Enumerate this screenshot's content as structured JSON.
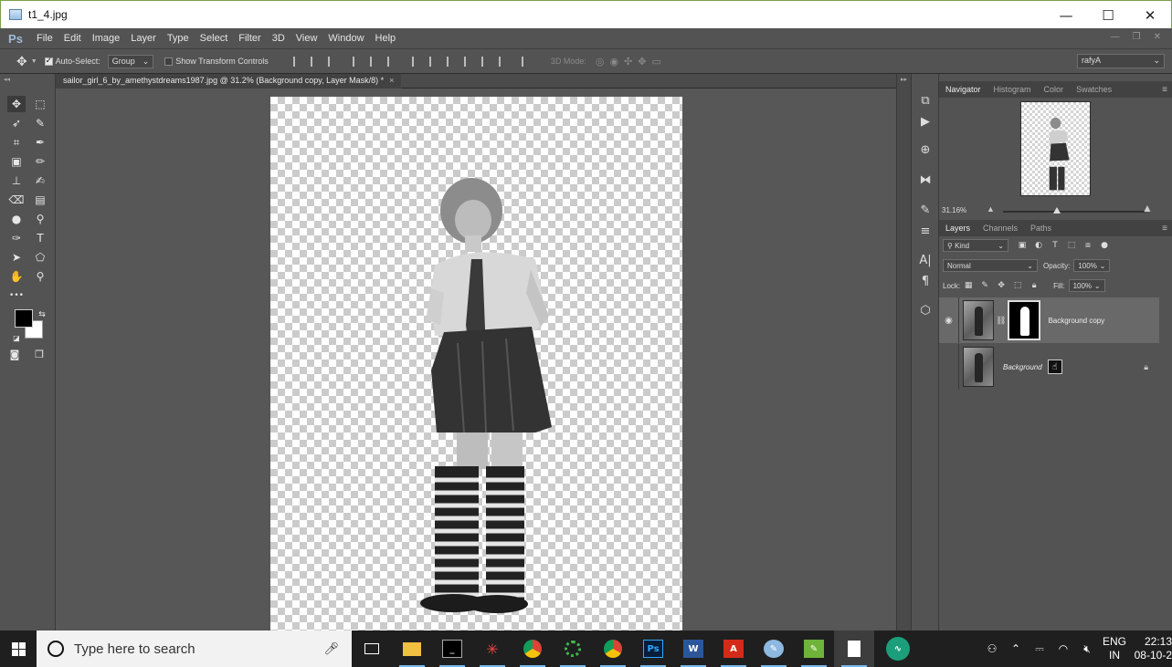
{
  "window": {
    "title": "t1_4.jpg",
    "min": "—",
    "max": "☐",
    "close": "✕"
  },
  "ps_logo": "Ps",
  "menus": [
    "File",
    "Edit",
    "Image",
    "Layer",
    "Type",
    "Select",
    "Filter",
    "3D",
    "View",
    "Window",
    "Help"
  ],
  "options": {
    "auto_select_label": "Auto-Select:",
    "auto_select_checked": true,
    "auto_select_value": "Group",
    "show_transform_label": "Show Transform Controls",
    "show_transform_checked": false,
    "mode_3d_label": "3D Mode:",
    "workspace": "rafyA"
  },
  "document": {
    "tab_title": "sailor_girl_6_by_amethystdreams1987.jpg @ 31.2% (Background copy, Layer Mask/8) *",
    "tab_close": "×"
  },
  "tools": [
    {
      "name": "move-tool",
      "glyph": "✥"
    },
    {
      "name": "marquee-tool",
      "glyph": "⬚"
    },
    {
      "name": "lasso-tool",
      "glyph": "➶"
    },
    {
      "name": "quick-select-tool",
      "glyph": "✎"
    },
    {
      "name": "crop-tool",
      "glyph": "⌗"
    },
    {
      "name": "eyedropper-tool",
      "glyph": "✒"
    },
    {
      "name": "healing-tool",
      "glyph": "▣"
    },
    {
      "name": "brush-tool",
      "glyph": "✏"
    },
    {
      "name": "stamp-tool",
      "glyph": "⊥"
    },
    {
      "name": "history-brush-tool",
      "glyph": "✍"
    },
    {
      "name": "eraser-tool",
      "glyph": "⌫"
    },
    {
      "name": "gradient-tool",
      "glyph": "▤"
    },
    {
      "name": "blur-tool",
      "glyph": "●"
    },
    {
      "name": "dodge-tool",
      "glyph": "⚲"
    },
    {
      "name": "pen-tool",
      "glyph": "✑"
    },
    {
      "name": "type-tool",
      "glyph": "T"
    },
    {
      "name": "path-select-tool",
      "glyph": "➤"
    },
    {
      "name": "shape-tool",
      "glyph": "⬠"
    },
    {
      "name": "hand-tool",
      "glyph": "✋"
    },
    {
      "name": "zoom-tool",
      "glyph": "⚲"
    },
    {
      "name": "more-tools",
      "glyph": "•••"
    }
  ],
  "panels": {
    "nav_tabs": [
      "Navigator",
      "Histogram",
      "Color",
      "Swatches"
    ],
    "zoom": "31.16%",
    "layer_tabs": [
      "Layers",
      "Channels",
      "Paths"
    ],
    "kind_label": "Kind",
    "blend_mode": "Normal",
    "opacity_label": "Opacity:",
    "opacity_value": "100%",
    "lock_label": "Lock:",
    "fill_label": "Fill:",
    "fill_value": "100%",
    "layers": [
      {
        "name": "Background copy",
        "visible": true,
        "selected": true,
        "has_mask": true
      },
      {
        "name": "Background",
        "visible": false,
        "selected": false,
        "locked": true
      }
    ]
  },
  "taskbar": {
    "search_placeholder": "Type here to search",
    "apps": [
      "task-view",
      "file-explorer",
      "terminal",
      "spider-app",
      "chrome",
      "green-ring-app",
      "chrome-2",
      "photoshop",
      "word",
      "acrobat",
      "paint-app",
      "notepad-app",
      "blank-file"
    ],
    "tray_lang_1": "ENG",
    "tray_lang_2": "IN",
    "time": "22:13",
    "date": "08-10-2"
  },
  "colors": {
    "ps_panel": "#535353",
    "ps_dark": "#424242",
    "accent": "#76b9ed"
  }
}
